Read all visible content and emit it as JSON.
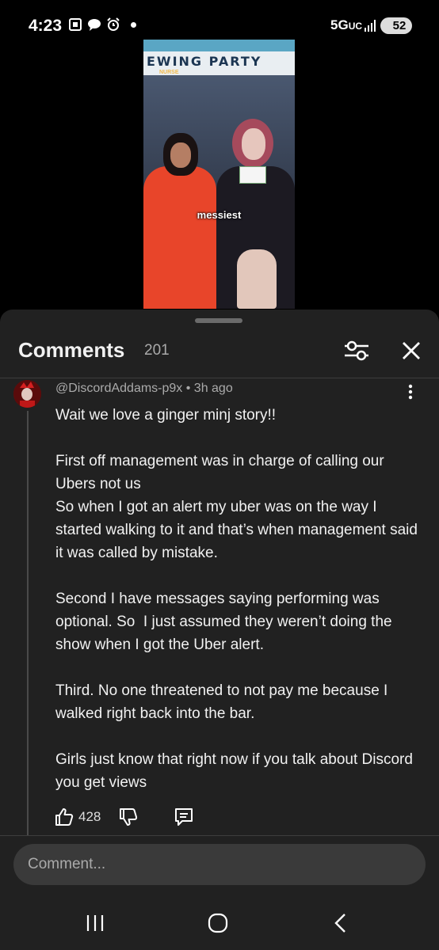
{
  "status_bar": {
    "time": "4:23",
    "network": "5G",
    "network_suffix": "UC",
    "battery": "52"
  },
  "video": {
    "banner_text": "EWING PARTY",
    "banner_sub": "NURSE",
    "caption": "messiest"
  },
  "comments_panel": {
    "title": "Comments",
    "count": "201",
    "comment": {
      "meta": "@DiscordAddams-p9x • 3h ago",
      "body": "Wait we love a ginger minj story!!\n\nFirst off management was in charge of calling our Ubers not us\nSo when I got an alert my uber was on the way I started walking to it and that’s when management said it was called by mistake.\n\nSecond I have messages saying performing was optional. So  I just assumed they weren’t doing the show when I got the Uber alert.\n\nThird. No one threatened to not pay me because I walked right back into the bar.\n\nGirls just know that right now if you talk about Discord you get views",
      "like_count": "428"
    },
    "input_placeholder": "Comment..."
  },
  "icons": {
    "filter": "sliders-icon",
    "close": "close-icon",
    "more": "more-vertical-icon",
    "like": "thumbs-up-icon",
    "dislike": "thumbs-down-icon",
    "reply": "reply-icon"
  }
}
